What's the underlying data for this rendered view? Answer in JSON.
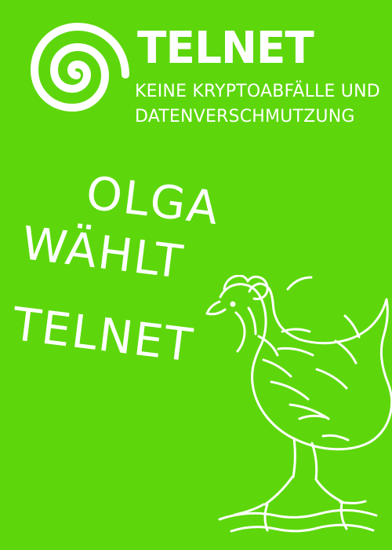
{
  "brand": {
    "name": "TELNET",
    "tagline_line1": "KEINE KRYPTOABFÄLLE UND",
    "tagline_line2": "DATENVERSCHMUTZUNG"
  },
  "headline": {
    "line1": "OLGA",
    "line2": "WÄHLT",
    "line3": "TELNET"
  },
  "colors": {
    "background": "#5dd70b",
    "foreground": "#ffffff"
  },
  "icons": {
    "logo": "spiral-icon",
    "illustration": "chicken-icon"
  }
}
